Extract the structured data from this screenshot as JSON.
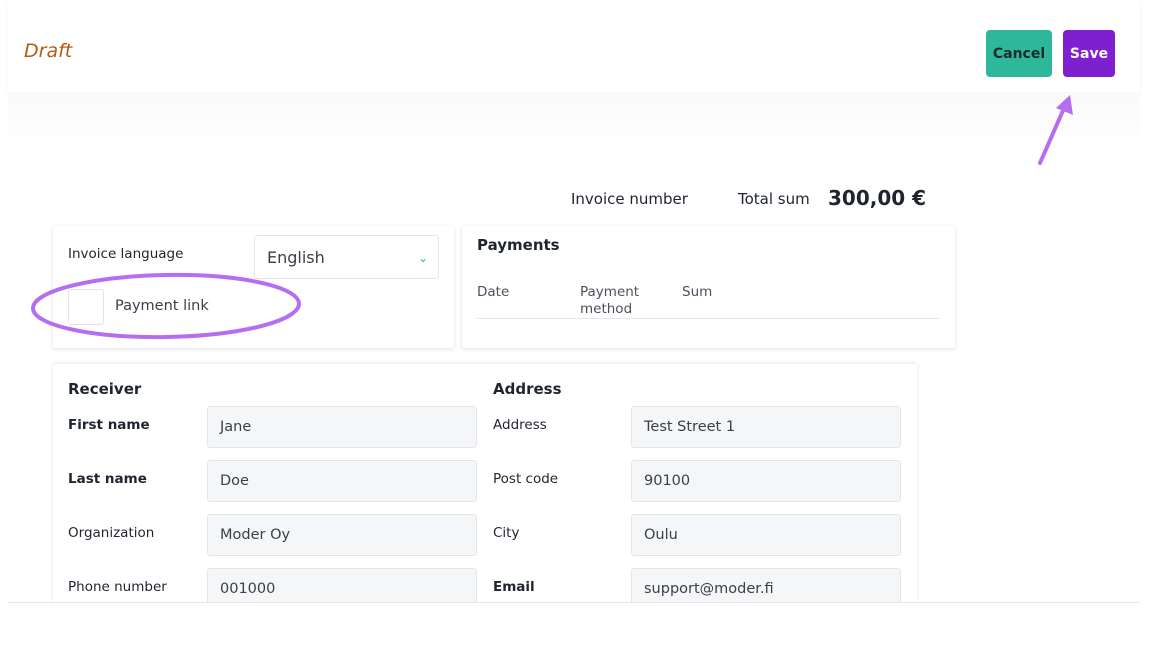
{
  "header": {
    "status": "Draft",
    "cancel_label": "Cancel",
    "save_label": "Save"
  },
  "summary": {
    "invoice_number_label": "Invoice number",
    "total_label": "Total sum",
    "total_value": "300,00 €"
  },
  "invoice_settings": {
    "language_label": "Invoice language",
    "language_value": "English",
    "payment_link_label": "Payment link"
  },
  "payments": {
    "title": "Payments",
    "columns": [
      "Date",
      "Payment\nmethod",
      "Sum"
    ]
  },
  "receiver": {
    "title": "Receiver",
    "fields": [
      {
        "label": "First name",
        "value": "Jane"
      },
      {
        "label": "Last name",
        "value": "Doe"
      },
      {
        "label": "Organization",
        "value": "Moder Oy"
      },
      {
        "label": "Phone number",
        "value": "001000"
      }
    ]
  },
  "address": {
    "title": "Address",
    "fields": [
      {
        "label": "Address",
        "value": "Test Street 1"
      },
      {
        "label": "Post code",
        "value": "90100"
      },
      {
        "label": "City",
        "value": "Oulu"
      },
      {
        "label": "Email",
        "value": "support@moder.fi"
      }
    ]
  },
  "colors": {
    "cancel": "#2fb79c",
    "save": "#7e1fd0",
    "status": "#b35c12",
    "annotation": "#b66ef0"
  },
  "icons": {
    "select_chevron": "chevron-down-icon",
    "annotation_arrow": "arrow-icon"
  }
}
